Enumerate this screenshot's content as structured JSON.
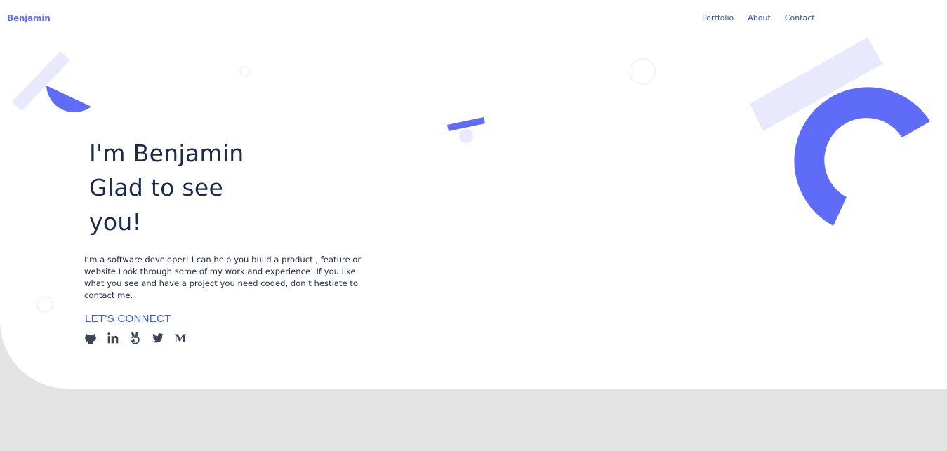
{
  "header": {
    "logo": "Benjamin",
    "nav": [
      "Portfolio",
      "About",
      "Contact"
    ]
  },
  "hero": {
    "heading_lines": [
      "I'm Benjamin",
      "Glad to see",
      "you!"
    ],
    "intro": "I’m a software developer! I can help you build a product , feature or website Look through some of my work and experience! If you like what you see and have a project you need coded, don’t hestiate to contact me.",
    "connect_label": "LET'S CONNECT",
    "socials": [
      "github-icon",
      "linkedin-icon",
      "angellist-icon",
      "twitter-icon",
      "medium-icon"
    ],
    "medium_glyph": "M"
  },
  "colors": {
    "accent": "#5f6cf7",
    "accent_light": "#e8e9fd",
    "heading": "#1b2a4a",
    "link": "#2457c5",
    "footer_bg": "#e3e3e3"
  }
}
